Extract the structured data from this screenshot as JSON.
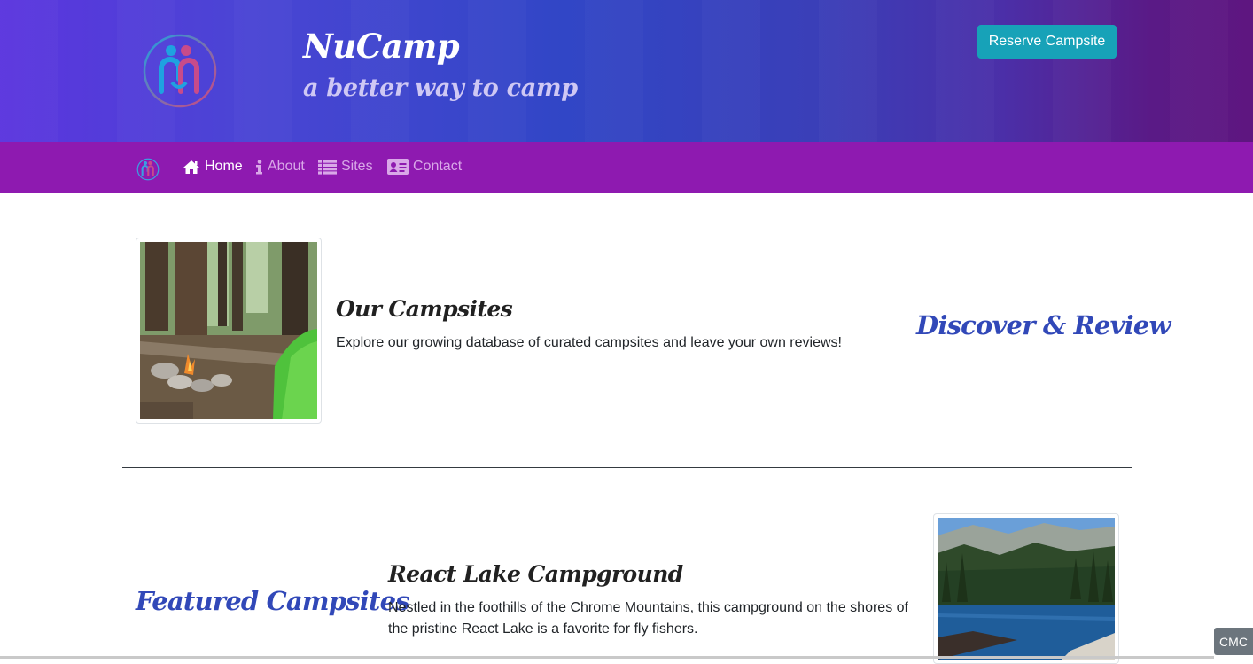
{
  "header": {
    "brand_name": "NuCamp",
    "tagline": "a better way to camp",
    "reserve_button": "Reserve Campsite",
    "logo_icon": "nucamp-logo-icon"
  },
  "nav": {
    "items": [
      {
        "label": "Home",
        "icon": "home-icon",
        "active": true
      },
      {
        "label": "About",
        "icon": "info-icon",
        "active": false
      },
      {
        "label": "Sites",
        "icon": "list-icon",
        "active": false
      },
      {
        "label": "Contact",
        "icon": "address-card-icon",
        "active": false
      }
    ]
  },
  "main": {
    "campsites": {
      "title": "Our Campsites",
      "text": "Explore our growing database of curated campsites and leave your own reviews!",
      "side_label": "Discover & Review"
    },
    "featured": {
      "section_label": "Featured Campsites",
      "title": "React Lake Campground",
      "text": "Nestled in the foothills of the Chrome Mountains, this campground on the shores of the pristine React Lake is a favorite for fly fishers."
    }
  },
  "badge": {
    "label": "CMC"
  },
  "colors": {
    "brand_purple": "#8e1ab0",
    "jumbotron_blue": "#3146c6",
    "accent_button": "#17a2b8",
    "section_label": "#3148b8"
  }
}
